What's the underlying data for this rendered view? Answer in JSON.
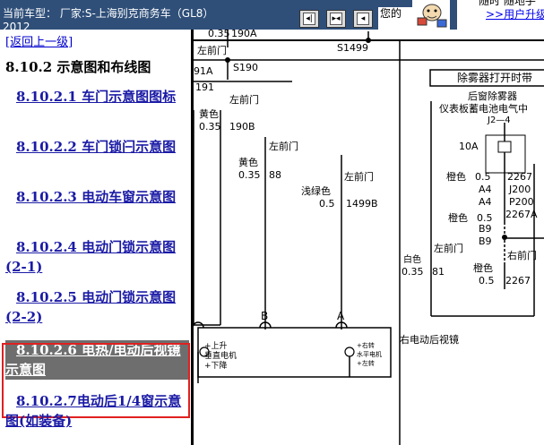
{
  "topbar": {
    "model_label": "当前车型：  厂家:S-上海别克商务车（GL8）",
    "model_line2": "2012",
    "nav_buttons": [
      "◂|",
      "▸◂",
      "◂"
    ],
    "greeting": "您的",
    "promo_line1": "随时 随地手",
    "promo_link": ">>用户升级"
  },
  "sidebar": {
    "back_link": "[返回上一级]",
    "section_heading": "8.10.2 示意图和布线图",
    "toc": [
      {
        "label": "8.10.2.1 车门示意图图标"
      },
      {
        "label": "8.10.2.2 车门锁闩示意图"
      },
      {
        "label": "8.10.2.3 电动车窗示意图"
      },
      {
        "label": "8.10.2.4 电动门锁示意图(2-1)"
      },
      {
        "label": "8.10.2.5 电动门锁示意图(2-2)"
      },
      {
        "label": "8.10.2.6 电热/电动后视镜示意图",
        "active": true
      },
      {
        "label": "8.10.2.7电动后1/4窗示意图(如装备)"
      }
    ]
  },
  "diagram": {
    "top_labels": {
      "w1": "0.35",
      "w1b": "190A",
      "s1499": "S1499",
      "lf_top": "左前门",
      "c91a": "91A",
      "s190": "S190",
      "c191": "191"
    },
    "wire1": {
      "door": "左前门",
      "color": "黄色",
      "gauge": "0.35",
      "circuit": "190B"
    },
    "wire2": {
      "color": "黄色",
      "gauge": "0.35",
      "circuit": "88"
    },
    "wire3": {
      "door": "左前门",
      "color": "浅绿色",
      "gauge": "0.5",
      "circuit": "1499B"
    },
    "wire4": {
      "door": "左前门"
    },
    "wire5": {
      "color": "白色",
      "gauge": "0.35",
      "circuit": "81"
    },
    "defog_box": "除雾器打开时带",
    "rear_defog": "后窗除雾器",
    "battery": "仪表板蓄电池电气中",
    "j2": "J2—4",
    "fuse": "10A",
    "orange1": {
      "color": "橙色",
      "gauge": "0.5",
      "circuit": "2267"
    },
    "a4": "A4",
    "j200": "J200",
    "p200": "P200",
    "c2267a": "2267A",
    "orange2": {
      "color": "橙色",
      "gauge": "0.5"
    },
    "b9": "B9",
    "lf_door_right": "左前门",
    "rf_door": "右前门",
    "orange3": {
      "color": "橙色",
      "gauge": "0.5",
      "circuit": "2267"
    },
    "conn_b": "B",
    "conn_a": "A",
    "motor_label": "右电动后视镜",
    "vmotor_up": "+上升",
    "vmotor": "垂直电机",
    "vmotor_down": "+下降",
    "hmotor_right": "+右转",
    "hmotor": "水平电机",
    "hmotor_left": "+左转"
  }
}
